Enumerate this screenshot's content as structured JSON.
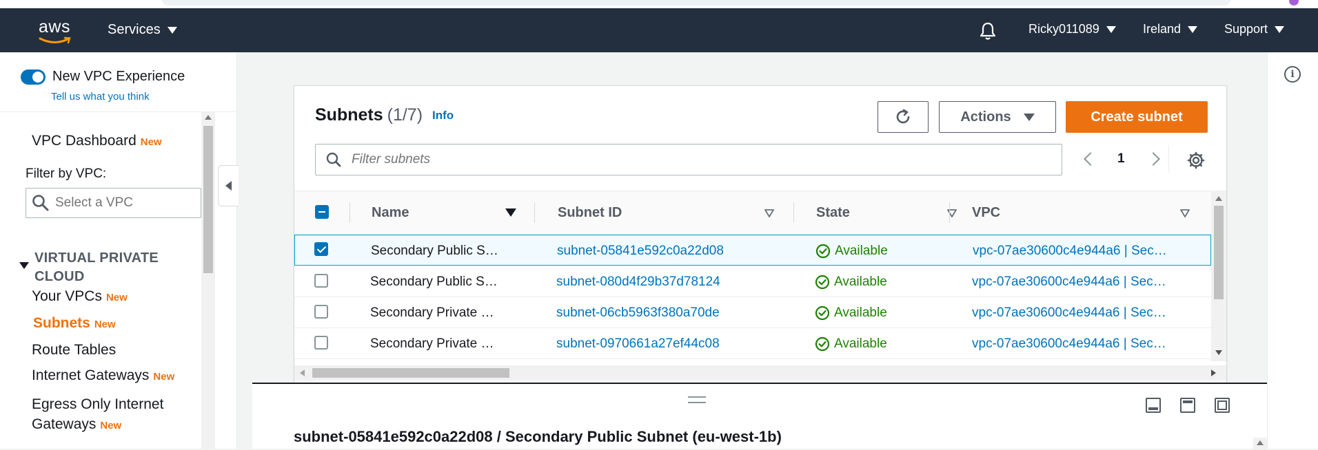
{
  "colors": {
    "topnav_bg": "#232f3e",
    "accent_orange": "#ec7211",
    "link_blue": "#0073bb",
    "success_green": "#1d8102",
    "selected_row_bg": "#f1faff"
  },
  "topnav": {
    "logo_text": "aws",
    "services_label": "Services",
    "bell_icon": "bell-icon",
    "user_label": "Ricky011089",
    "region_label": "Ireland",
    "support_label": "Support"
  },
  "sidebar": {
    "toggle_label": "New VPC Experience",
    "toggle_on": true,
    "tell_us_link": "Tell us what you think",
    "dashboard_label": "VPC Dashboard",
    "dashboard_badge": "New",
    "filter_label": "Filter by VPC:",
    "vpc_select_placeholder": "Select a VPC",
    "section_title": "VIRTUAL PRIVATE CLOUD",
    "items": [
      {
        "label": "Your VPCs",
        "badge": "New"
      },
      {
        "label": "Subnets",
        "badge": "New"
      },
      {
        "label": "Route Tables",
        "badge": ""
      },
      {
        "label": "Internet Gateways",
        "badge": "New"
      },
      {
        "label": "Egress Only Internet Gateways",
        "badge": "New"
      }
    ]
  },
  "subnets": {
    "title": "Subnets",
    "count": "(1/7)",
    "info_link": "Info",
    "actions_label": "Actions",
    "create_label": "Create subnet",
    "filter_placeholder": "Filter subnets",
    "current_page": "1",
    "columns": [
      "Name",
      "Subnet ID",
      "State",
      "VPC"
    ],
    "rows": [
      {
        "name": "Secondary Public S…",
        "subnet_id": "subnet-05841e592c0a22d08",
        "state": "Available",
        "vpc": "vpc-07ae30600c4e944a6 | Sec…",
        "selected": true
      },
      {
        "name": "Secondary Public S…",
        "subnet_id": "subnet-080d4f29b37d78124",
        "state": "Available",
        "vpc": "vpc-07ae30600c4e944a6 | Sec…",
        "selected": false
      },
      {
        "name": "Secondary Private …",
        "subnet_id": "subnet-06cb5963f380a70de",
        "state": "Available",
        "vpc": "vpc-07ae30600c4e944a6 | Sec…",
        "selected": false
      },
      {
        "name": "Secondary Private …",
        "subnet_id": "subnet-0970661a27ef44c08",
        "state": "Available",
        "vpc": "vpc-07ae30600c4e944a6 | Sec…",
        "selected": false
      }
    ]
  },
  "split_panel": {
    "title": "subnet-05841e592c0a22d08 / Secondary Public Subnet (eu-west-1b)"
  }
}
